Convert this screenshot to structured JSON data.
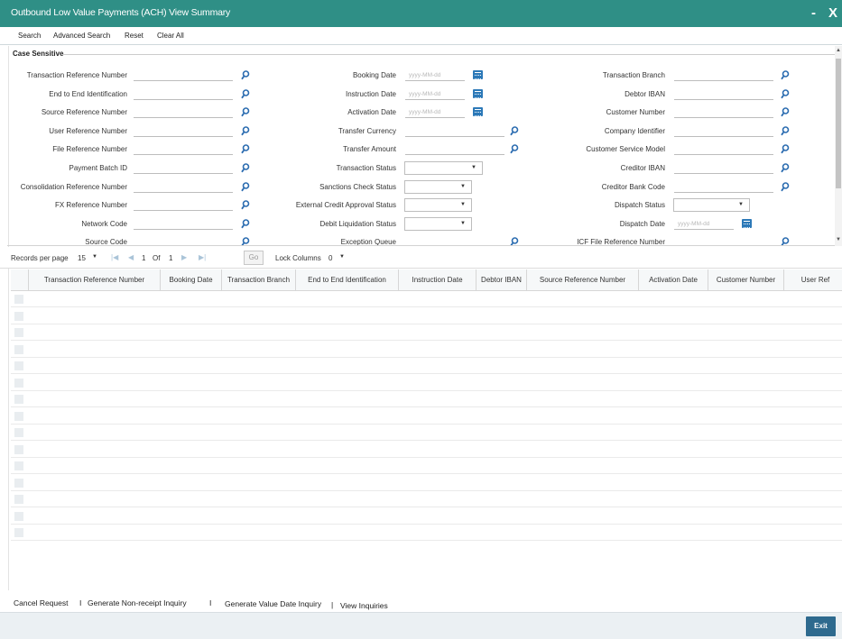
{
  "window": {
    "title": "Outbound Low Value Payments (ACH) View Summary",
    "minimize": "-",
    "close": "X"
  },
  "toolbar": {
    "search": "Search",
    "advanced_search": "Advanced Search",
    "reset": "Reset",
    "clear_all": "Clear All"
  },
  "section": {
    "case_sensitive": "Case Sensitive"
  },
  "fields": {
    "transaction_reference_number": "Transaction Reference Number",
    "end_to_end_identification": "End to End Identification",
    "source_reference_number": "Source Reference Number",
    "user_reference_number": "User Reference Number",
    "file_reference_number": "File Reference Number",
    "payment_batch_id": "Payment Batch ID",
    "consolidation_reference_number": "Consolidation Reference Number",
    "fx_reference_number": "FX Reference Number",
    "network_code": "Network Code",
    "source_code": "Source Code",
    "booking_date": "Booking Date",
    "instruction_date": "Instruction Date",
    "activation_date": "Activation Date",
    "transfer_currency": "Transfer Currency",
    "transfer_amount": "Transfer Amount",
    "transaction_status": "Transaction Status",
    "sanctions_check_status": "Sanctions Check Status",
    "external_credit_approval_status": "External Credit Approval Status",
    "debit_liquidation_status": "Debit Liquidation Status",
    "exception_queue": "Exception Queue",
    "transaction_branch": "Transaction Branch",
    "debtor_iban": "Debtor IBAN",
    "customer_number": "Customer Number",
    "company_identifier": "Company Identifier",
    "customer_service_model": "Customer Service Model",
    "creditor_iban": "Creditor IBAN",
    "creditor_bank_code": "Creditor Bank Code",
    "dispatch_status": "Dispatch Status",
    "dispatch_date": "Dispatch Date",
    "icf_file_reference_number": "ICF File Reference Number"
  },
  "date_placeholder": "yyyy-MM-dd",
  "pager": {
    "records_per_page_label": "Records per page",
    "records_per_page_value": "15",
    "current_page": "1",
    "of_label": "Of",
    "total_pages": "1",
    "go_label": "Go",
    "lock_columns_label": "Lock Columns",
    "lock_columns_value": "0"
  },
  "grid": {
    "columns": [
      "Transaction Reference Number",
      "Booking Date",
      "Transaction Branch",
      "End to End Identification",
      "Instruction Date",
      "Debtor IBAN",
      "Source Reference Number",
      "Activation Date",
      "Customer Number",
      "User Ref"
    ],
    "row_count": 15
  },
  "bottom_links": {
    "cancel_request": "Cancel Request",
    "sep1": "I",
    "generate_non_receipt_inquiry": "Generate Non-receipt Inquiry",
    "sep2": "I",
    "generate_value_date_inquiry": "Generate Value Date Inquiry",
    "sep3": "|",
    "view_inquiries": "View Inquiries"
  },
  "footer": {
    "exit": "Exit"
  },
  "colors": {
    "titlebar": "#2f8f86",
    "exit_button": "#2e6a8e",
    "search_icon": "#2b6cb0",
    "calendar_icon": "#2c79b8"
  }
}
